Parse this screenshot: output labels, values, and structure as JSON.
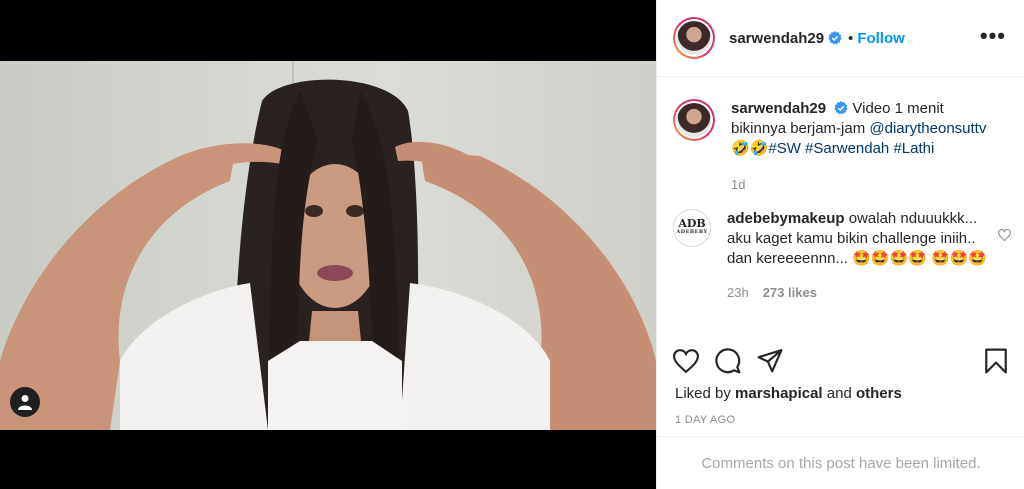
{
  "post": {
    "username": "sarwendah29",
    "follow_label": "Follow",
    "dot": "•",
    "more_label": "•••"
  },
  "caption": {
    "username": "sarwendah29",
    "text_1": "Video 1 menit bikinnya berjam-jam ",
    "mention": "@diarytheonsuttv",
    "emoji": " 🤣🤣",
    "hashtag_1": "#SW",
    "hashtag_2": "#Sarwendah",
    "hashtag_3": "#Lathi",
    "time": "1d"
  },
  "comment": {
    "avatar_text": "ADB",
    "avatar_subtext": "ADEBEBY",
    "username": "adebebymakeup",
    "text": "owalah nduuukkk... aku kaget kamu bikin challenge iniih.. dan kereeeennn... 🤩🤩🤩🤩 🤩🤩🤩",
    "time": "23h",
    "likes": "273 likes"
  },
  "engagement": {
    "liked_prefix": "Liked by ",
    "liked_user": "marshapical",
    "liked_and": " and ",
    "liked_others": "others",
    "timestamp": "1 DAY AGO",
    "comments_limited": "Comments on this post have been limited."
  },
  "icons": {
    "like": "heart-icon",
    "comment": "comment-icon",
    "share": "share-icon",
    "save": "bookmark-icon",
    "user_tag": "user-icon",
    "verified": "verified-badge-icon"
  },
  "colors": {
    "link": "#00376b",
    "follow": "#0095f6",
    "verified": "#3897f0",
    "muted": "#8e8e8e"
  }
}
